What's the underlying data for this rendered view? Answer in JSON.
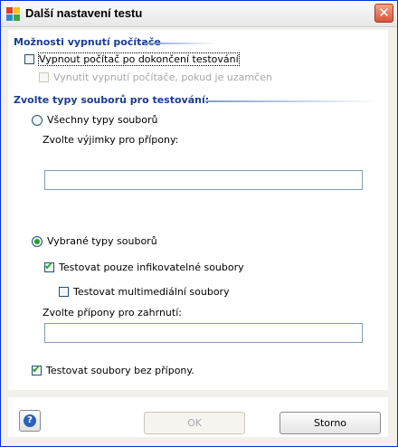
{
  "window": {
    "title": "Další nastavení testu",
    "close_symbol": "✕"
  },
  "shutdown_section": {
    "title": "Možnosti vypnutí počítače",
    "shutdown_after_scan": {
      "label": "Vypnout počítač po dokončení testování",
      "checked": false
    },
    "force_shutdown_locked": {
      "label": "Vynutit vypnutí počítače, pokud je uzamčen",
      "checked": false,
      "disabled": true
    }
  },
  "file_types_section": {
    "title": "Zvolte typy souborů pro testování:",
    "all_types": {
      "label": "Všechny typy souborů",
      "selected": false
    },
    "exceptions_label": "Zvolte výjimky pro přípony:",
    "exceptions_value": "",
    "selected_types": {
      "label": "Vybrané typy souborů",
      "selected": true
    },
    "infectable_only": {
      "label": "Testovat pouze infikovatelné soubory",
      "checked": true
    },
    "multimedia": {
      "label": "Testovat multimediální soubory",
      "checked": false
    },
    "include_label": "Zvolte přípony pro zahrnutí:",
    "include_value": "",
    "no_extension": {
      "label": "Testovat soubory bez přípony.",
      "checked": true
    }
  },
  "buttons": {
    "help_symbol": "?",
    "ok_label": "OK",
    "cancel_label": "Storno"
  },
  "icons": {
    "app": "avg-logo-icon",
    "check": "checkmark-icon",
    "help": "help-icon"
  },
  "colors": {
    "section_title": "#1a3d8f",
    "check_green": "#21a121",
    "field_border": "#7f9db9"
  }
}
